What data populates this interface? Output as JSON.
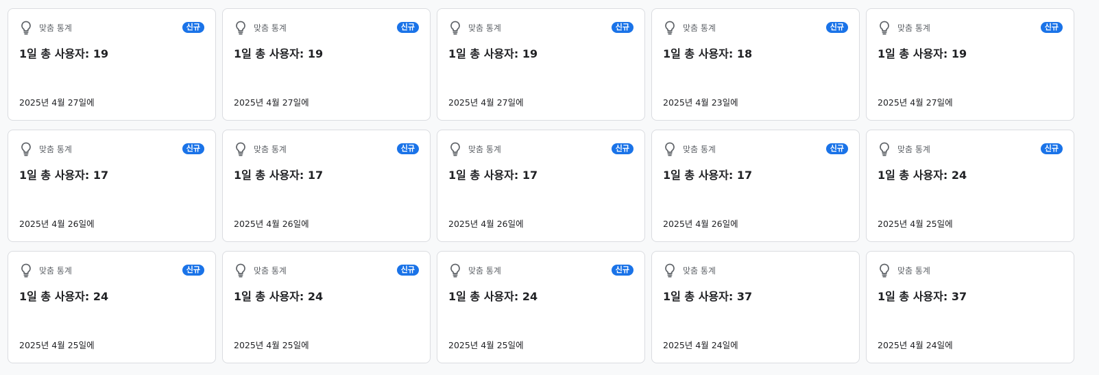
{
  "cards": [
    {
      "category": "맞춤 통계",
      "badge": "신규",
      "metric": "1일 총 사용자: 19",
      "date": "2025년 4월 27일에"
    },
    {
      "category": "맞춤 통계",
      "badge": "신규",
      "metric": "1일 총 사용자: 19",
      "date": "2025년 4월 27일에"
    },
    {
      "category": "맞춤 통계",
      "badge": "신규",
      "metric": "1일 총 사용자: 19",
      "date": "2025년 4월 27일에"
    },
    {
      "category": "맞춤 통계",
      "badge": "신규",
      "metric": "1일 총 사용자: 18",
      "date": "2025년 4월 23일에"
    },
    {
      "category": "맞춤 통계",
      "badge": "신규",
      "metric": "1일 총 사용자: 19",
      "date": "2025년 4월 27일에"
    },
    {
      "category": "맞춤 통계",
      "badge": "신규",
      "metric": "1일 총 사용자: 17",
      "date": "2025년 4월 26일에"
    },
    {
      "category": "맞춤 통계",
      "badge": "신규",
      "metric": "1일 총 사용자: 17",
      "date": "2025년 4월 26일에"
    },
    {
      "category": "맞춤 통계",
      "badge": "신규",
      "metric": "1일 총 사용자: 17",
      "date": "2025년 4월 26일에"
    },
    {
      "category": "맞춤 통계",
      "badge": "신규",
      "metric": "1일 총 사용자: 17",
      "date": "2025년 4월 26일에"
    },
    {
      "category": "맞춤 통계",
      "badge": "신규",
      "metric": "1일 총 사용자: 24",
      "date": "2025년 4월 25일에"
    },
    {
      "category": "맞춤 통계",
      "badge": "신규",
      "metric": "1일 총 사용자: 24",
      "date": "2025년 4월 25일에"
    },
    {
      "category": "맞춤 통계",
      "badge": "신규",
      "metric": "1일 총 사용자: 24",
      "date": "2025년 4월 25일에"
    },
    {
      "category": "맞춤 통계",
      "badge": "신규",
      "metric": "1일 총 사용자: 24",
      "date": "2025년 4월 25일에"
    },
    {
      "category": "맞춤 통계",
      "badge": "",
      "metric": "1일 총 사용자: 37",
      "date": "2025년 4월 24일에"
    },
    {
      "category": "맞춤 통계",
      "badge": "",
      "metric": "1일 총 사용자: 37",
      "date": "2025년 4월 24일에"
    }
  ],
  "icons": {
    "insight": "lightbulb-icon"
  },
  "colors": {
    "badge": "#1a73e8",
    "icon": "#5f6368",
    "card_border": "#dadce0",
    "page_bg": "#f8f9fa"
  }
}
